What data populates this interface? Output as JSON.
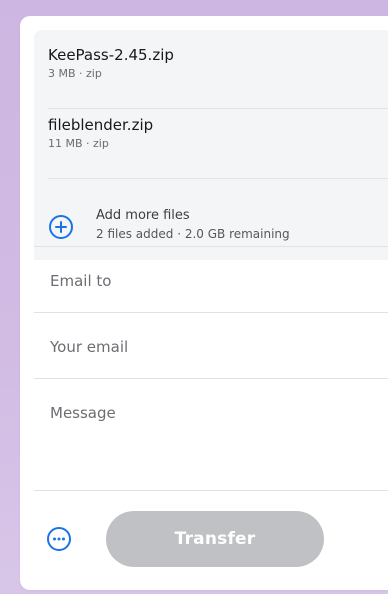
{
  "files": [
    {
      "name": "KeePass-2.45.zip",
      "meta": "3 MB · zip"
    },
    {
      "name": "fileblender.zip",
      "meta": "11 MB · zip"
    }
  ],
  "add_more": {
    "title": "Add more files",
    "meta": "2 files added · 2.0 GB remaining"
  },
  "form": {
    "email_to_placeholder": "Email to",
    "your_email_placeholder": "Your email",
    "message_placeholder": "Message"
  },
  "actions": {
    "transfer_label": "Transfer"
  },
  "icons": {
    "add": "plus-circle-icon",
    "more": "more-options-icon"
  },
  "colors": {
    "accent": "#1a73e8",
    "button_disabled": "#bfc1c4"
  }
}
